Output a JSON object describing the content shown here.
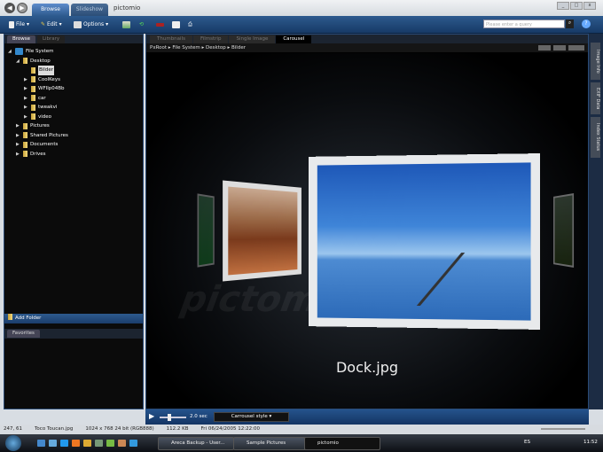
{
  "app": {
    "logo": "pictomio",
    "tabs": [
      "Browse",
      "Slideshow"
    ]
  },
  "toolbar": {
    "file": "File",
    "edit": "Edit",
    "options": "Options",
    "search_placeholder": "Please enter a query"
  },
  "left": {
    "tabs": [
      "Browse",
      "Library"
    ],
    "tree": [
      {
        "label": "File System",
        "level": 0,
        "arrow": "◢"
      },
      {
        "label": "Desktop",
        "level": 1,
        "arrow": "◢"
      },
      {
        "label": "Bilder",
        "level": 2,
        "arrow": "",
        "selected": true
      },
      {
        "label": "CoolKeys",
        "level": 2,
        "arrow": "▶"
      },
      {
        "label": "WFIlp04Bb",
        "level": 2,
        "arrow": "▶"
      },
      {
        "label": "car",
        "level": 2,
        "arrow": "▶"
      },
      {
        "label": "tweakvi",
        "level": 2,
        "arrow": "▶"
      },
      {
        "label": "video",
        "level": 2,
        "arrow": "▶"
      },
      {
        "label": "Pictures",
        "level": 1,
        "arrow": "▶"
      },
      {
        "label": "Shared Pictures",
        "level": 1,
        "arrow": "▶"
      },
      {
        "label": "Documents",
        "level": 1,
        "arrow": "▶"
      },
      {
        "label": "Drives",
        "level": 1,
        "arrow": "▶"
      }
    ],
    "add_folder": "Add Folder",
    "favorites_tab": "Favorites"
  },
  "main": {
    "tabs": [
      "Thumbnails",
      "Filmstrip",
      "Single Image",
      "Carousel"
    ],
    "breadcrumb": [
      "PxRoot",
      "File System",
      "Desktop",
      "Bilder"
    ],
    "caption": "Dock.jpg",
    "watermark": "pictomio"
  },
  "right_tabs": [
    "Image Info",
    "EXIF Data",
    "Index Status"
  ],
  "controls": {
    "interval": "2.0 sec",
    "style": "Carrousel style"
  },
  "status": {
    "coords": "247, 61",
    "file": "Toco Toucan.jpg",
    "dims": "1024 x 768 24 bit (RGB888)",
    "size": "112.2 KB",
    "date": "Fri 06/24/2005 12:22:00"
  },
  "taskbar": {
    "tasks": [
      "Areca Backup - User...",
      "Sample Pictures",
      "pictomio"
    ],
    "lang": "ES",
    "time": "11:52"
  }
}
